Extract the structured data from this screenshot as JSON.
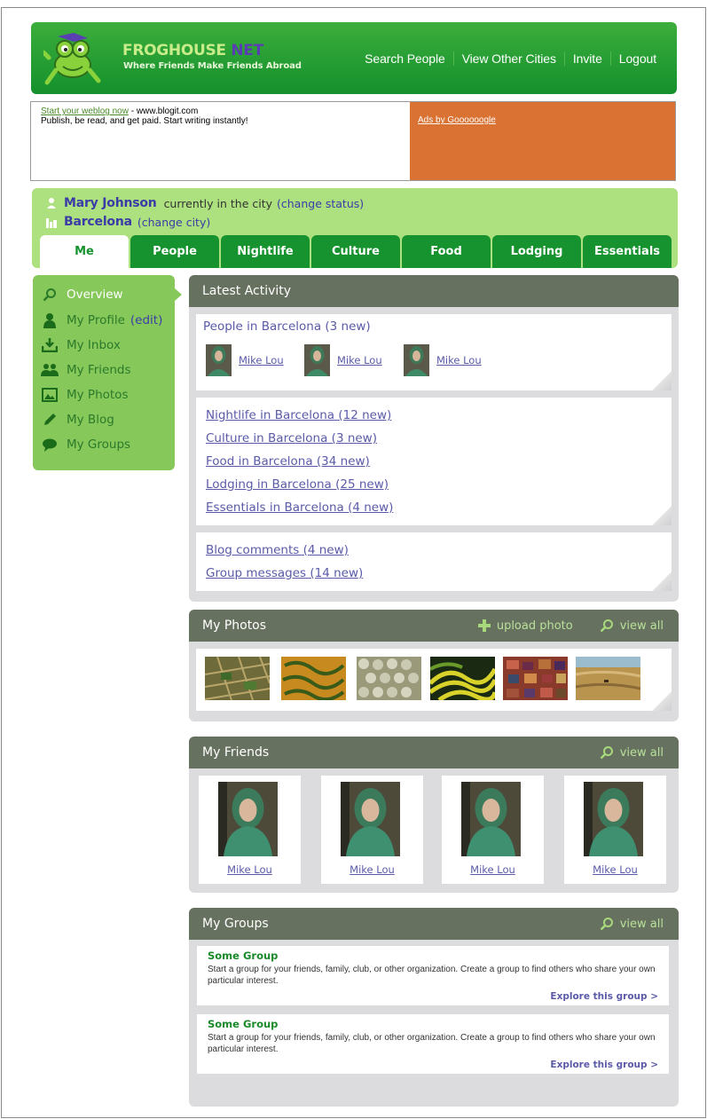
{
  "header": {
    "brand": "FROGHOUSE",
    "brand_suffix": "NET",
    "tagline": "Where Friends Make Friends Abroad",
    "nav": [
      "Search People",
      "View Other Cities",
      "Invite",
      "Logout"
    ]
  },
  "ad": {
    "link": "Start your weblog now",
    "sep": " - www.blogit.com",
    "text": "Publish, be read, and get paid. Start writing instantly!",
    "google": "Ads by Goooooogle"
  },
  "status": {
    "name": "Mary Johnson",
    "status_text": "currently in the city",
    "change_status": "(change status)",
    "city": "Barcelona",
    "change_city": "(change city)"
  },
  "tabs": [
    "Me",
    "People",
    "Nightlife",
    "Culture",
    "Food",
    "Lodging",
    "Essentials"
  ],
  "sidenav": {
    "items": [
      "Overview",
      "My Profile",
      "My Inbox",
      "My Friends",
      "My Photos",
      "My Blog",
      "My Groups"
    ],
    "edit": "(edit)"
  },
  "activity": {
    "title": "Latest Activity",
    "people_title": "People in Barcelona (3 new)",
    "people": [
      "Mike Lou",
      "Mike Lou",
      "Mike Lou"
    ],
    "links": [
      "Nightlife in Barcelona (12 new)",
      "Culture in Barcelona (3 new)",
      "Food in Barcelona (34 new)",
      "Lodging in Barcelona (25 new)",
      "Essentials in Barcelona (4 new)"
    ],
    "links2": [
      "Blog comments (4 new)",
      "Group messages (14 new)"
    ]
  },
  "photos": {
    "title": "My Photos",
    "upload": "upload photo",
    "view_all": "view all"
  },
  "friends": {
    "title": "My Friends",
    "view_all": "view all",
    "names": [
      "Mike Lou",
      "Mike Lou",
      "Mike Lou",
      "Mike Lou"
    ]
  },
  "groups": {
    "title": "My Groups",
    "view_all": "view all",
    "items": [
      {
        "name": "Some Group",
        "desc": "Start a group for your friends, family, club, or other organization. Create a group to find others who share your own particular interest.",
        "explore": "Explore this group >"
      },
      {
        "name": "Some Group",
        "desc": "Start a group for your friends, family, club, or other organization. Create a group to find others who share your own particular interest.",
        "explore": "Explore this group >"
      }
    ]
  },
  "colors": {
    "header_green": "#14902c",
    "status_green": "#ade07e",
    "sidenav_green": "#86c95a",
    "panel_head": "#67715f",
    "link_purple": "#5a5aa8",
    "ad_orange": "#d97232"
  }
}
